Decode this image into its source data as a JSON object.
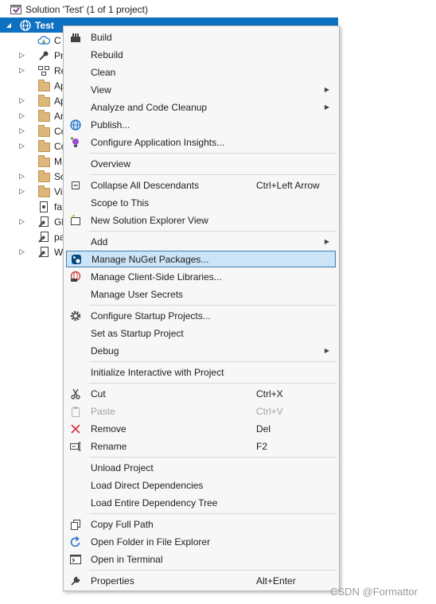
{
  "solution": {
    "title": "Solution 'Test' (1 of 1 project)"
  },
  "project": {
    "name": "Test"
  },
  "children": [
    {
      "label": "C",
      "icon": "cloud-icon",
      "expandable": false
    },
    {
      "label": "Pr",
      "icon": "wrench-icon",
      "expandable": true
    },
    {
      "label": "Re",
      "icon": "references-icon",
      "expandable": true
    },
    {
      "label": "Ap",
      "icon": "folder-icon",
      "expandable": false
    },
    {
      "label": "Ap",
      "icon": "folder-icon",
      "expandable": true
    },
    {
      "label": "Ar",
      "icon": "folder-icon",
      "expandable": true
    },
    {
      "label": "Co",
      "icon": "folder-icon",
      "expandable": true
    },
    {
      "label": "Co",
      "icon": "folder-icon",
      "expandable": true
    },
    {
      "label": "M",
      "icon": "folder-icon",
      "expandable": false
    },
    {
      "label": "Sc",
      "icon": "folder-icon",
      "expandable": true
    },
    {
      "label": "Vi",
      "icon": "folder-icon",
      "expandable": true
    },
    {
      "label": "fa",
      "icon": "file-icon",
      "expandable": false
    },
    {
      "label": "Gl",
      "icon": "config-file-icon",
      "expandable": true
    },
    {
      "label": "pa",
      "icon": "config-file-icon",
      "expandable": false
    },
    {
      "label": "W",
      "icon": "config-file-icon",
      "expandable": true
    }
  ],
  "menu": {
    "build": "Build",
    "rebuild": "Rebuild",
    "clean": "Clean",
    "view": "View",
    "analyze": "Analyze and Code Cleanup",
    "publish": "Publish...",
    "insights": "Configure Application Insights...",
    "overview": "Overview",
    "collapse": "Collapse All Descendants",
    "collapse_shortcut": "Ctrl+Left Arrow",
    "scope": "Scope to This",
    "new_view": "New Solution Explorer View",
    "add": "Add",
    "nuget": "Manage NuGet Packages...",
    "client_libs": "Manage Client-Side Libraries...",
    "user_secrets": "Manage User Secrets",
    "startup_projects": "Configure Startup Projects...",
    "set_startup": "Set as Startup Project",
    "debug": "Debug",
    "interactive": "Initialize Interactive with Project",
    "cut": "Cut",
    "cut_shortcut": "Ctrl+X",
    "paste": "Paste",
    "paste_shortcut": "Ctrl+V",
    "remove": "Remove",
    "remove_shortcut": "Del",
    "rename": "Rename",
    "rename_shortcut": "F2",
    "unload": "Unload Project",
    "load_direct": "Load Direct Dependencies",
    "load_tree": "Load Entire Dependency Tree",
    "copy_path": "Copy Full Path",
    "open_folder": "Open Folder in File Explorer",
    "open_terminal": "Open in Terminal",
    "properties": "Properties",
    "properties_shortcut": "Alt+Enter"
  },
  "watermark": "CSDN @Formattor",
  "colors": {
    "selection": "#0e70c0",
    "highlight": "#cce4f7",
    "highlight_border": "#3c7fb1"
  }
}
